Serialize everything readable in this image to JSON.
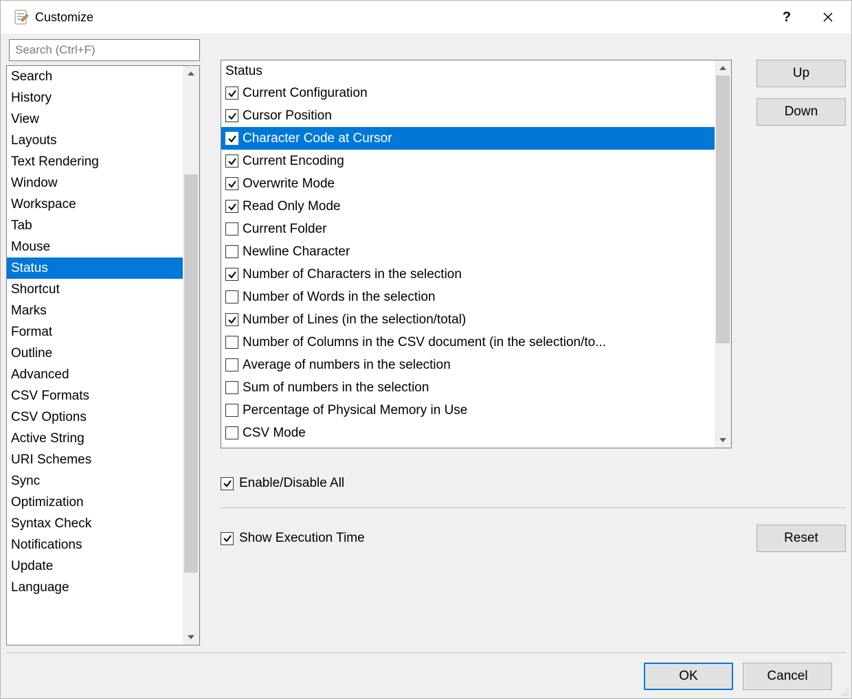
{
  "window": {
    "title": "Customize"
  },
  "search": {
    "placeholder": "Search (Ctrl+F)",
    "value": ""
  },
  "nav": {
    "selected_index": 9,
    "items": [
      "Search",
      "History",
      "View",
      "Layouts",
      "Text Rendering",
      "Window",
      "Workspace",
      "Tab",
      "Mouse",
      "Status",
      "Shortcut",
      "Marks",
      "Format",
      "Outline",
      "Advanced",
      "CSV Formats",
      "CSV Options",
      "Active String",
      "URI Schemes",
      "Sync",
      "Optimization",
      "Syntax Check",
      "Notifications",
      "Update",
      "Language"
    ]
  },
  "status_panel": {
    "header": "Status",
    "selected_index": 2,
    "items": [
      {
        "label": "Current Configuration",
        "checked": true
      },
      {
        "label": "Cursor Position",
        "checked": true
      },
      {
        "label": "Character Code at Cursor",
        "checked": true
      },
      {
        "label": "Current Encoding",
        "checked": true
      },
      {
        "label": "Overwrite Mode",
        "checked": true
      },
      {
        "label": "Read Only Mode",
        "checked": true
      },
      {
        "label": "Current Folder",
        "checked": false
      },
      {
        "label": "Newline Character",
        "checked": false
      },
      {
        "label": "Number of Characters in the selection",
        "checked": true
      },
      {
        "label": "Number of Words in the selection",
        "checked": false
      },
      {
        "label": "Number of Lines (in the selection/total)",
        "checked": true
      },
      {
        "label": "Number of Columns in the CSV document (in the selection/to...",
        "checked": false
      },
      {
        "label": "Average of numbers in the selection",
        "checked": false
      },
      {
        "label": "Sum of numbers in the selection",
        "checked": false
      },
      {
        "label": "Percentage of Physical Memory in Use",
        "checked": false
      },
      {
        "label": "CSV Mode",
        "checked": false
      }
    ]
  },
  "buttons": {
    "up": "Up",
    "down": "Down",
    "reset": "Reset",
    "ok": "OK",
    "cancel": "Cancel"
  },
  "options": {
    "enable_all": {
      "label": "Enable/Disable All",
      "checked": true
    },
    "show_exec_time": {
      "label": "Show Execution Time",
      "checked": true
    }
  }
}
